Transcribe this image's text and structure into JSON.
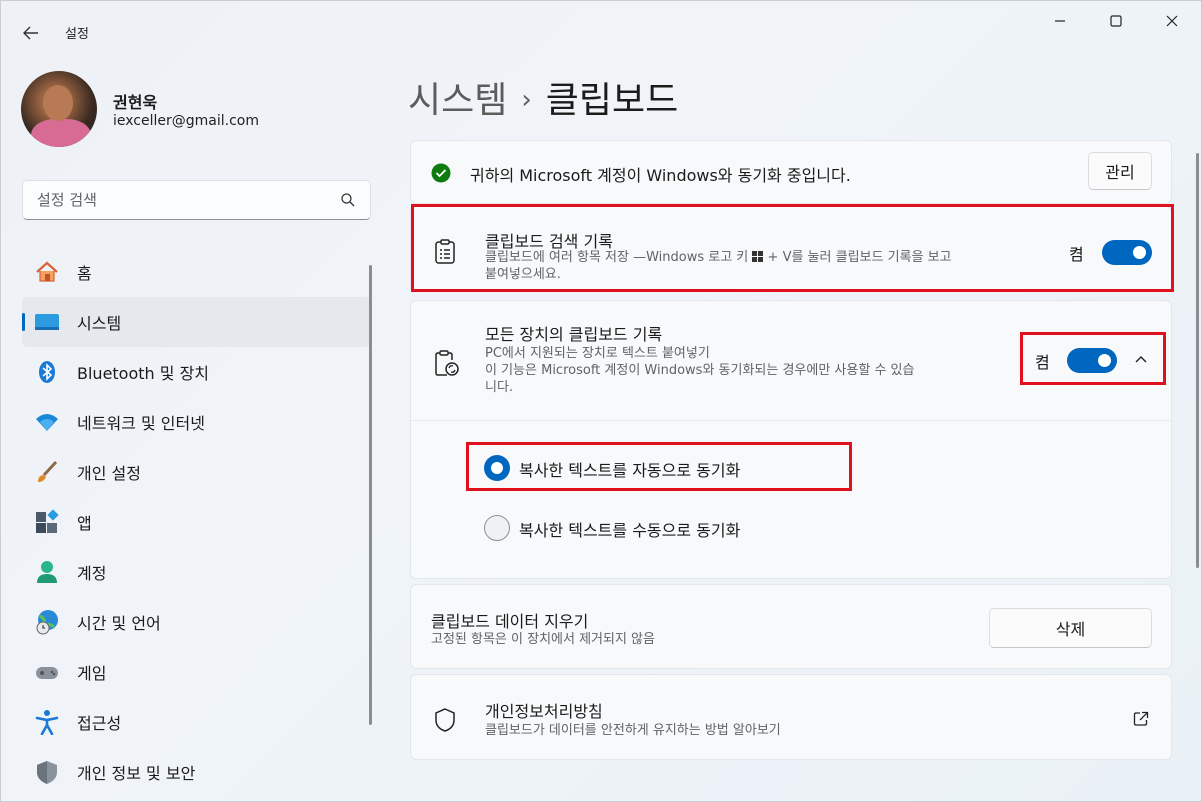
{
  "window": {
    "app_title": "설정",
    "controls": [
      "minimize",
      "maximize",
      "close"
    ]
  },
  "profile": {
    "name": "권현욱",
    "email": "iexceller@gmail.com"
  },
  "search": {
    "placeholder": "설정 검색"
  },
  "sidebar": {
    "items": [
      {
        "label": "홈",
        "icon": "home-icon"
      },
      {
        "label": "시스템",
        "icon": "system-icon",
        "active": true
      },
      {
        "label": "Bluetooth 및 장치",
        "icon": "bluetooth-icon"
      },
      {
        "label": "네트워크 및 인터넷",
        "icon": "wifi-icon"
      },
      {
        "label": "개인 설정",
        "icon": "brush-icon"
      },
      {
        "label": "앱",
        "icon": "apps-icon"
      },
      {
        "label": "계정",
        "icon": "account-icon"
      },
      {
        "label": "시간 및 언어",
        "icon": "globe-clock-icon"
      },
      {
        "label": "게임",
        "icon": "gamepad-icon"
      },
      {
        "label": "접근성",
        "icon": "accessibility-icon"
      },
      {
        "label": "개인 정보 및 보안",
        "icon": "shield-icon"
      }
    ]
  },
  "breadcrumb": {
    "parent": "시스템",
    "separator": "›",
    "current": "클립보드"
  },
  "sync_banner": {
    "text": "귀하의 Microsoft 계정이 Windows와 동기화 중입니다.",
    "button": "관리"
  },
  "clipboard_history": {
    "title": "클립보드 검색 기록",
    "desc_line1": "클립보드에 여러 항목 저장 —Windows 로고 키",
    "desc_line1_after": "+ V를 눌러 클립보드 기록을 보고",
    "desc_line2": "붙여넣으세요.",
    "toggle_label": "켬",
    "toggle_on": true
  },
  "sync_devices": {
    "title": "모든 장치의 클립보드 기록",
    "desc_line1": "PC에서 지원되는 장치로 텍스트 붙여넣기",
    "desc_line2": "이 기능은 Microsoft 계정이 Windows와 동기화되는 경우에만 사용할 수 있습",
    "desc_line3": "니다.",
    "toggle_label": "켬",
    "toggle_on": true,
    "options": [
      {
        "label": "복사한 텍스트를 자동으로 동기화",
        "selected": true
      },
      {
        "label": "복사한 텍스트를 수동으로 동기화",
        "selected": false
      }
    ]
  },
  "clear_data": {
    "title": "클립보드 데이터 지우기",
    "desc": "고정된 항목은 이 장치에서 제거되지 않음",
    "button": "삭제"
  },
  "privacy": {
    "title": "개인정보처리방침",
    "desc": "클립보드가 데이터를 안전하게 유지하는 방법 알아보기"
  },
  "colors": {
    "accent": "#0067c0",
    "highlight": "#e0101d",
    "success": "#0f7b0f"
  }
}
